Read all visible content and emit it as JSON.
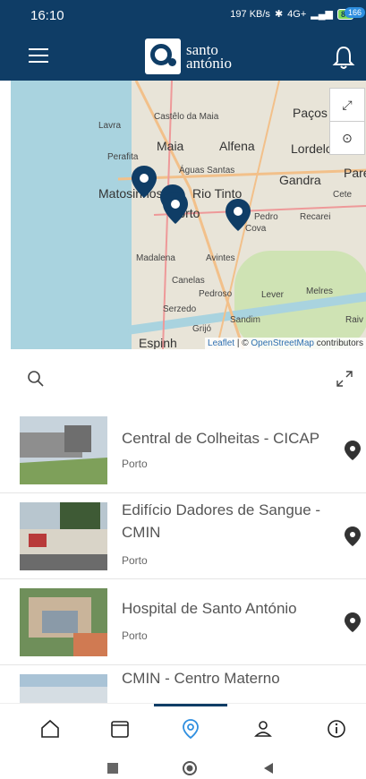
{
  "status": {
    "time": "16:10",
    "speed": "197 KB/s",
    "network": "4G+",
    "battery": "89"
  },
  "header": {
    "logo_line1": "santo",
    "logo_line2": "antónio",
    "notifications": "166"
  },
  "map": {
    "places": [
      "Castêlo da Maia",
      "Paços",
      "Lavra",
      "Maia",
      "Alfena",
      "Lordelo",
      "Perafita",
      "Águas Santas",
      "Gandra",
      "Pare",
      "Matosinhos",
      "Rio Tinto",
      "Cete",
      "Porto",
      "Pedro",
      "Cova",
      "Recarei",
      "Madalena",
      "Avintes",
      "Canelas",
      "Pedroso",
      "Lever",
      "Melres",
      "Serzedo",
      "Sandim",
      "Raiv",
      "Grijó",
      "Espinh"
    ],
    "attribution_leaflet": "Leaflet",
    "attribution_sep": " | © ",
    "attribution_osm": "OpenStreetMap",
    "attribution_tail": " contributors"
  },
  "locations": [
    {
      "title": "Central de Colheitas - CICAP",
      "city": "Porto"
    },
    {
      "title": "Edifício Dadores de Sangue - CMIN",
      "city": "Porto"
    },
    {
      "title": "Hospital de Santo António",
      "city": "Porto"
    },
    {
      "title": "CMIN - Centro Materno",
      "city": ""
    }
  ],
  "colors": {
    "brand": "#0f3d66",
    "accent": "#2f8fe0"
  }
}
